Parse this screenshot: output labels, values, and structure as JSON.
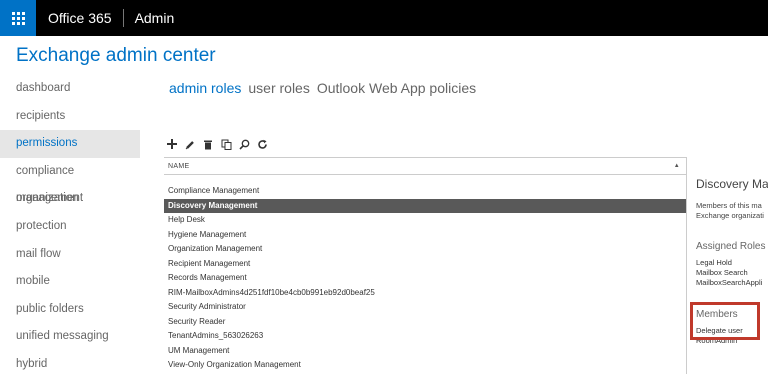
{
  "topbar": {
    "app_name": "Office 365",
    "admin_label": "Admin"
  },
  "page_title": "Exchange admin center",
  "nav": [
    {
      "label": "dashboard"
    },
    {
      "label": "recipients"
    },
    {
      "label": "permissions",
      "active": true
    },
    {
      "label": "compliance management"
    },
    {
      "label": "organization"
    },
    {
      "label": "protection"
    },
    {
      "label": "mail flow"
    },
    {
      "label": "mobile"
    },
    {
      "label": "public folders"
    },
    {
      "label": "unified messaging"
    },
    {
      "label": "hybrid"
    }
  ],
  "tabs": [
    {
      "label": "admin roles",
      "active": true
    },
    {
      "label": "user roles"
    },
    {
      "label": "Outlook Web App policies"
    }
  ],
  "toolbar": {
    "icons": [
      "add-icon",
      "edit-icon",
      "delete-icon",
      "copy-icon",
      "search-icon",
      "refresh-icon"
    ]
  },
  "table": {
    "header": "NAME",
    "rows": [
      "Compliance Management",
      "Discovery Management",
      "Help Desk",
      "Hygiene Management",
      "Organization Management",
      "Recipient Management",
      "Records Management",
      "RIM-MailboxAdmins4d251fdf10be4cb0b991eb92d0beaf25",
      "Security Administrator",
      "Security Reader",
      "TenantAdmins_563026263",
      "UM Management",
      "View-Only Organization Management"
    ],
    "selected_row": "Discovery Management"
  },
  "details": {
    "title": "Discovery Mar",
    "description_lines": [
      "Members of this ma",
      "Exchange organizati"
    ],
    "assigned_roles_heading": "Assigned Roles",
    "assigned_roles": [
      "Legal Hold",
      "Mailbox Search",
      "MailboxSearchAppli"
    ],
    "members_heading": "Members",
    "members": [
      "Delegate user",
      "RoomAdmin"
    ]
  },
  "colors": {
    "accent": "#0072c6",
    "highlight": "#c0392b",
    "selected_row": "#595959",
    "topbar": "#000000"
  }
}
